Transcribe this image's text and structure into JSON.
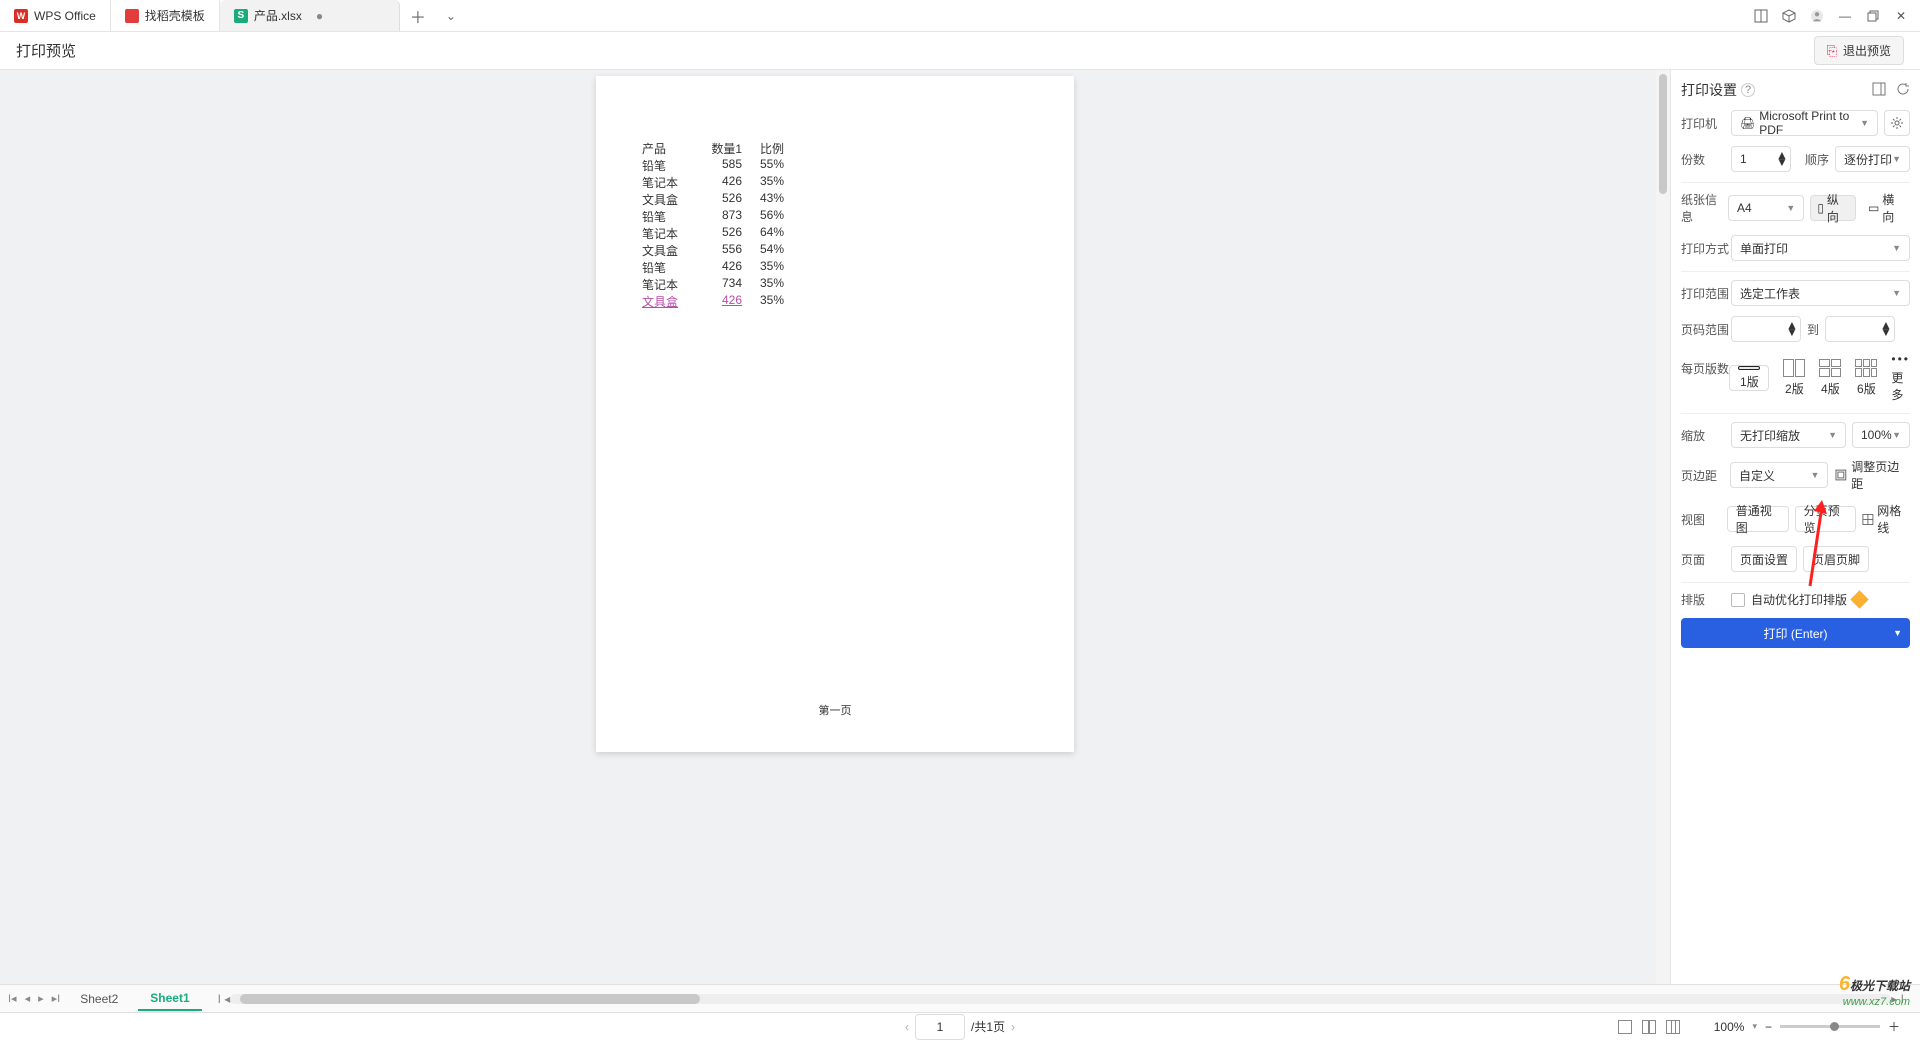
{
  "titlebar": {
    "tabs": [
      {
        "label": "WPS Office",
        "icon": "W"
      },
      {
        "label": "找稻壳模板"
      },
      {
        "label": "产品.xlsx",
        "icon": "S"
      }
    ],
    "tab_close": "●",
    "add": "＋",
    "dropdown": "⌄"
  },
  "subhead": {
    "title": "打印预览",
    "exit": "退出预览"
  },
  "preview": {
    "headers": [
      "产品",
      "数量1",
      "比例"
    ],
    "rows": [
      {
        "c1": "铅笔",
        "c2": "585",
        "c3": "55%"
      },
      {
        "c1": "笔记本",
        "c2": "426",
        "c3": "35%"
      },
      {
        "c1": "文具盒",
        "c2": "526",
        "c3": "43%"
      },
      {
        "c1": "铅笔",
        "c2": "873",
        "c3": "56%"
      },
      {
        "c1": "笔记本",
        "c2": "526",
        "c3": "64%"
      },
      {
        "c1": "文具盒",
        "c2": "556",
        "c3": "54%"
      },
      {
        "c1": "铅笔",
        "c2": "426",
        "c3": "35%"
      },
      {
        "c1": "笔记本",
        "c2": "734",
        "c3": "35%"
      },
      {
        "c1": "文具盒",
        "c2": "426",
        "c3": "35%"
      }
    ],
    "footer": "第一页"
  },
  "panel": {
    "title": "打印设置",
    "printer_lbl": "打印机",
    "printer_val": "Microsoft Print to PDF",
    "copies_lbl": "份数",
    "copies_val": "1",
    "order_lbl": "顺序",
    "order_val": "逐份打印",
    "paper_lbl": "纸张信息",
    "paper_val": "A4",
    "portrait": "纵向",
    "landscape": "横向",
    "method_lbl": "打印方式",
    "method_val": "单面打印",
    "range_lbl": "打印范围",
    "range_val": "选定工作表",
    "pagerange_lbl": "页码范围",
    "to": "到",
    "perpage_lbl": "每页版数",
    "t1": "1版",
    "t2": "2版",
    "t4": "4版",
    "t6": "6版",
    "tmore": "更多",
    "scale_lbl": "缩放",
    "scale_val": "无打印缩放",
    "scale_pct": "100%",
    "margin_lbl": "页边距",
    "margin_val": "自定义",
    "margin_adj": "调整页边距",
    "view_lbl": "视图",
    "view_normal": "普通视图",
    "view_page": "分页预览",
    "view_grid": "网格线",
    "page_lbl": "页面",
    "page_setup": "页面设置",
    "page_hf": "页眉页脚",
    "layout_lbl": "排版",
    "auto_opt": "自动优化打印排版",
    "print_btn": "打印 (Enter)"
  },
  "sheets": {
    "s2": "Sheet2",
    "s1": "Sheet1"
  },
  "status": {
    "page_cur": "1",
    "page_total": "/共1页",
    "zoom": "100%"
  },
  "watermark": {
    "l1": "极光下载站",
    "l2": "www.xz7.com"
  }
}
